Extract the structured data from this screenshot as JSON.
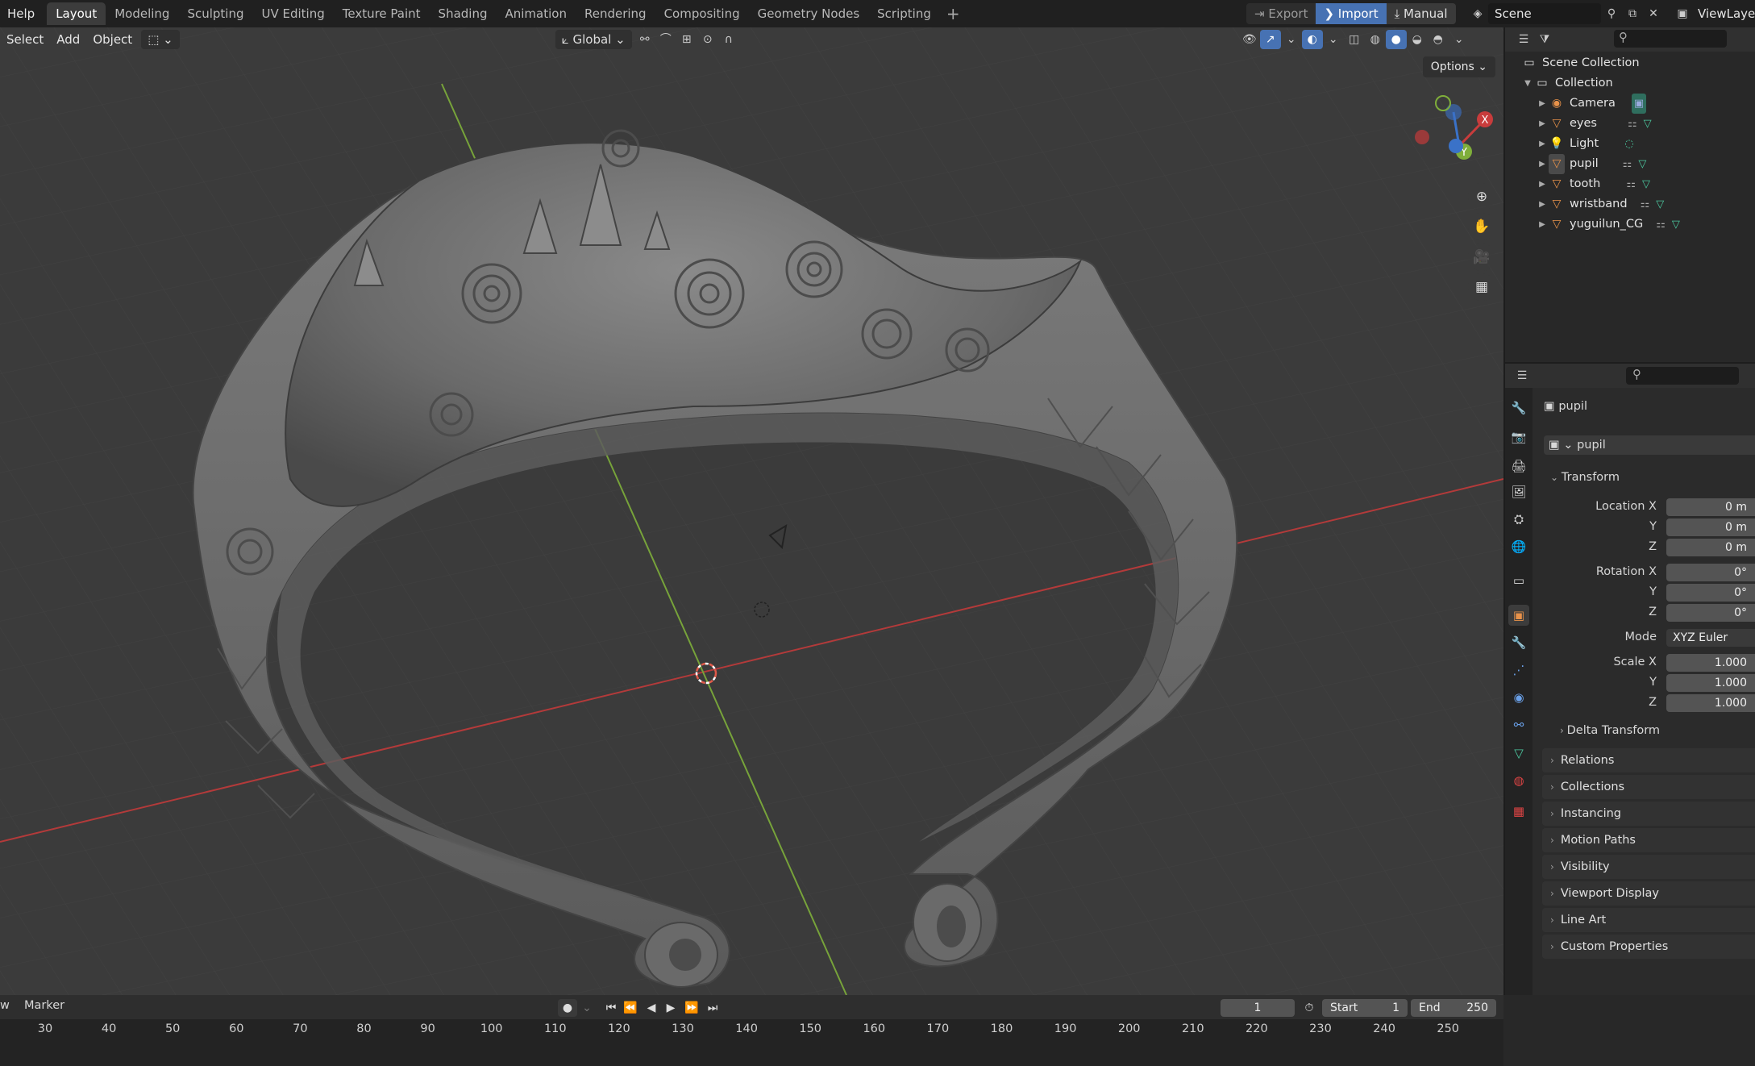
{
  "topbar": {
    "help": "Help",
    "workspaces": [
      "Layout",
      "Modeling",
      "Sculpting",
      "UV Editing",
      "Texture Paint",
      "Shading",
      "Animation",
      "Rendering",
      "Compositing",
      "Geometry Nodes",
      "Scripting"
    ],
    "active_workspace": "Layout",
    "add_workspace": "+",
    "export_label": "Export",
    "import_label": "Import",
    "manual_label": "Manual",
    "scene_name": "Scene",
    "view_layer": "ViewLayer"
  },
  "viewport": {
    "menu": [
      "Select",
      "Add",
      "Object"
    ],
    "transform_orientation": "Global",
    "options_label": "Options"
  },
  "gizmo": {
    "x": "X",
    "y": "Y"
  },
  "outliner": {
    "scene_collection": "Scene Collection",
    "collection": "Collection",
    "items": [
      {
        "name": "Camera",
        "icon": "camera-icon"
      },
      {
        "name": "eyes",
        "icon": "mesh-icon"
      },
      {
        "name": "Light",
        "icon": "light-icon"
      },
      {
        "name": "pupil",
        "icon": "mesh-icon"
      },
      {
        "name": "tooth",
        "icon": "mesh-icon"
      },
      {
        "name": "wristband",
        "icon": "mesh-icon"
      },
      {
        "name": "yuguilun_CG",
        "icon": "mesh-icon"
      }
    ]
  },
  "properties": {
    "object_name": "pupil",
    "datablock_name": "pupil",
    "transform_label": "Transform",
    "location_x_label": "Location X",
    "y_label": "Y",
    "z_label": "Z",
    "location": [
      "0 m",
      "0 m",
      "0 m"
    ],
    "rotation_x_label": "Rotation X",
    "rotation": [
      "0°",
      "0°",
      "0°"
    ],
    "mode_label": "Mode",
    "mode_value": "XYZ Euler",
    "scale_x_label": "Scale X",
    "scale": [
      "1.000",
      "1.000",
      "1.000"
    ],
    "delta_transform": "Delta Transform",
    "panels": [
      "Relations",
      "Collections",
      "Instancing",
      "Motion Paths",
      "Visibility",
      "Viewport Display",
      "Line Art",
      "Custom Properties"
    ]
  },
  "timeline": {
    "view_partial": "w",
    "marker": "Marker",
    "current_frame": "1",
    "start_label": "Start",
    "start_value": "1",
    "end_label": "End",
    "end_value": "250",
    "ticks": [
      "30",
      "40",
      "50",
      "60",
      "70",
      "80",
      "90",
      "100",
      "110",
      "120",
      "130",
      "140",
      "150",
      "160",
      "170",
      "180",
      "190",
      "200",
      "210",
      "220",
      "230",
      "240",
      "250"
    ]
  },
  "colors": {
    "accent": "#4772b3",
    "x_axis": "#c83c3c",
    "y_axis": "#7fae3a",
    "object_orange": "#e8924a"
  }
}
